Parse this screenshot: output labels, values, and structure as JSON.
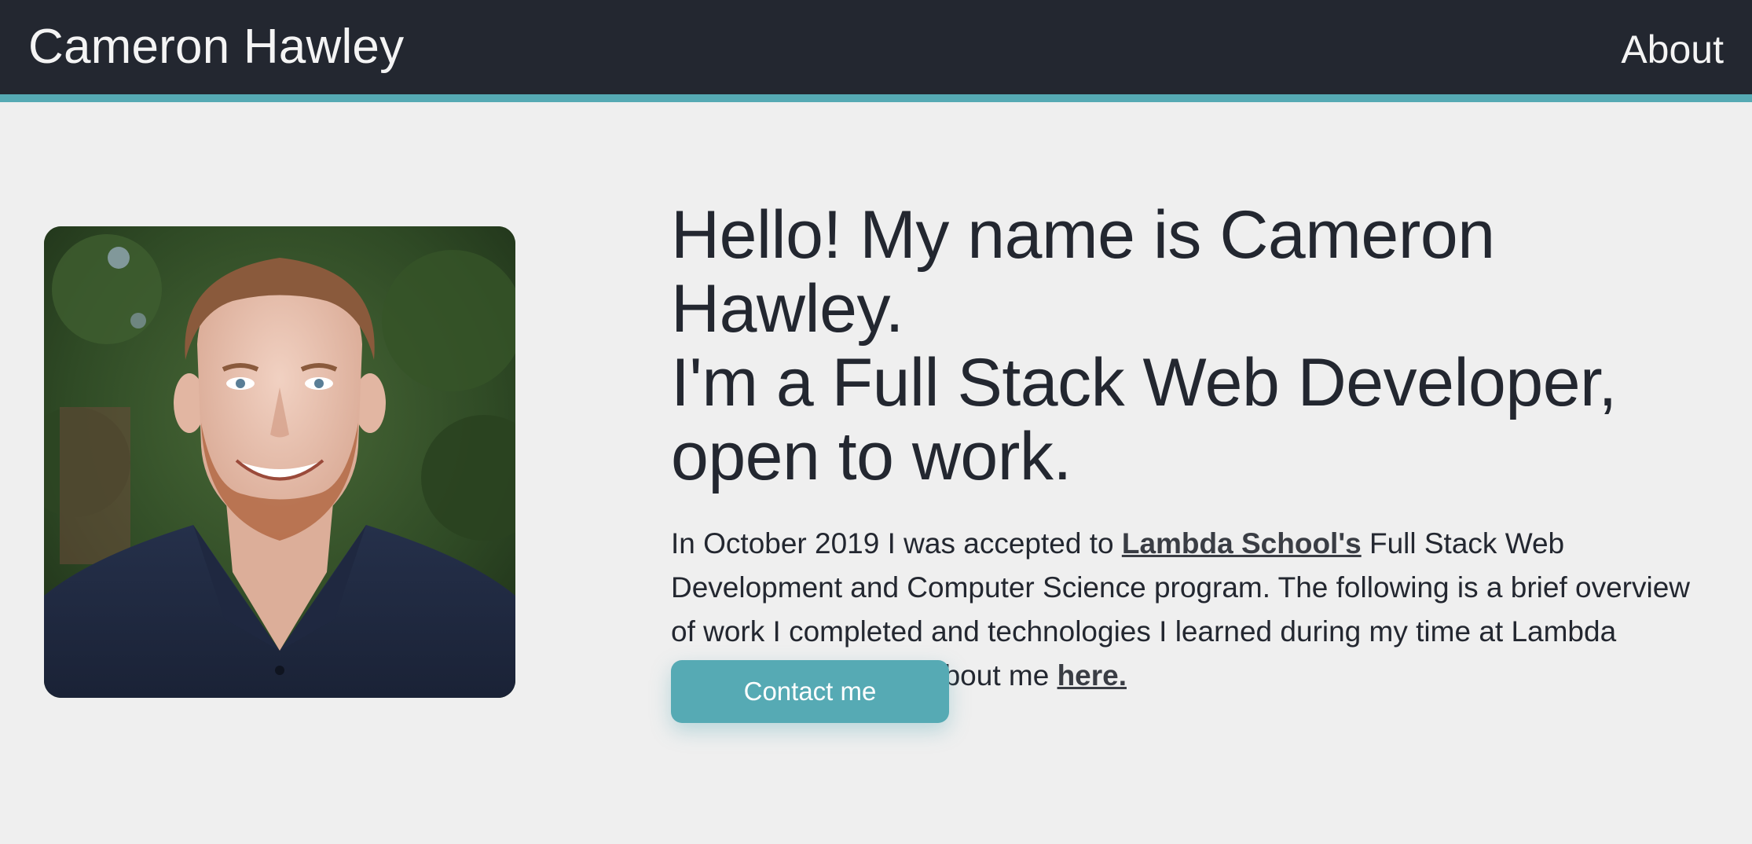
{
  "header": {
    "brand": "Cameron Hawley",
    "nav_about": "About"
  },
  "hero": {
    "photo_alt": "Cameron Hawley",
    "headline_lines": [
      "Hello! My name is Cameron Hawley.",
      "I'm a Full Stack Web Developer,",
      "open to work."
    ],
    "intro": {
      "before_link": "In October 2019 I was accepted to ",
      "link_lambda": "Lambda School's",
      "middle": " Full Stack Web Development and Computer Science program. The following is a brief overview of work I completed and technologies I learned during my time at Lambda School. Read more about me ",
      "link_here": "here."
    },
    "contact_button": "Contact me"
  },
  "colors": {
    "header_bg": "#232730",
    "accent": "#56aab4",
    "page_bg": "#efefef",
    "text": "#232730"
  }
}
